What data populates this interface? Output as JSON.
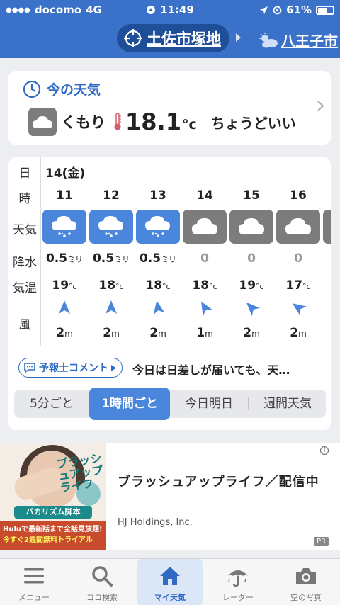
{
  "status_bar": {
    "carrier": "docomo",
    "network": "4G",
    "time": "11:49",
    "battery": "61%"
  },
  "header": {
    "current_location": "土佐市塚地",
    "next_location": "八王子市"
  },
  "now": {
    "title": "今の天気",
    "weather": "くもり",
    "temp": "18.1",
    "unit": "°c",
    "feel": "ちょうどいい"
  },
  "hourly": {
    "date": "14(金)",
    "row_labels": [
      "日",
      "時",
      "天気",
      "降水",
      "気温",
      "風"
    ],
    "hours": [
      {
        "hour": "11",
        "weather": "rain",
        "precip": "0.5",
        "precip_unit": "ミリ",
        "temp": "19",
        "temp_unit": "°c",
        "wind": "2",
        "wind_unit": "m",
        "dir": 0
      },
      {
        "hour": "12",
        "weather": "rain",
        "precip": "0.5",
        "precip_unit": "ミリ",
        "temp": "18",
        "temp_unit": "°c",
        "wind": "2",
        "wind_unit": "m",
        "dir": 0
      },
      {
        "hour": "13",
        "weather": "rain",
        "precip": "0.5",
        "precip_unit": "ミリ",
        "temp": "18",
        "temp_unit": "°c",
        "wind": "2",
        "wind_unit": "m",
        "dir": -10
      },
      {
        "hour": "14",
        "weather": "cloudy",
        "precip": "0",
        "precip_unit": "",
        "temp": "18",
        "temp_unit": "°c",
        "wind": "1",
        "wind_unit": "m",
        "dir": -30
      },
      {
        "hour": "15",
        "weather": "cloudy",
        "precip": "0",
        "precip_unit": "",
        "temp": "19",
        "temp_unit": "°c",
        "wind": "2",
        "wind_unit": "m",
        "dir": -45
      },
      {
        "hour": "16",
        "weather": "cloudy",
        "precip": "0",
        "precip_unit": "",
        "temp": "17",
        "temp_unit": "°c",
        "wind": "2",
        "wind_unit": "m",
        "dir": -55
      }
    ],
    "comment_button": "予報士コメント",
    "comment": "今日は日差しが届いても、天…",
    "tabs": [
      "5分ごと",
      "1時間ごと",
      "今日明日",
      "週間天気"
    ],
    "active_tab": 1
  },
  "ad": {
    "title": "ブラッシュアップライフ／配信中",
    "company": "HJ Holdings, Inc.",
    "pr": "PR",
    "info": "i",
    "image_logo": "ブラッシュアップライフ",
    "image_bar1": "バカリズム脚本",
    "image_bar2_a": "Huluで最新話まで全話見放題!",
    "image_bar2_b": "今すぐ2週間無料トライアル"
  },
  "nav": [
    {
      "label": "メニュー",
      "icon": "menu-icon"
    },
    {
      "label": "ココ検索",
      "icon": "search-icon"
    },
    {
      "label": "マイ天気",
      "icon": "home-icon"
    },
    {
      "label": "レーダー",
      "icon": "umbrella-icon"
    },
    {
      "label": "空の写真",
      "icon": "camera-icon"
    }
  ],
  "colors": {
    "brand_blue": "#3a72c9",
    "rain_box": "#4a86dc",
    "cloud_box": "#7c7c7c"
  }
}
